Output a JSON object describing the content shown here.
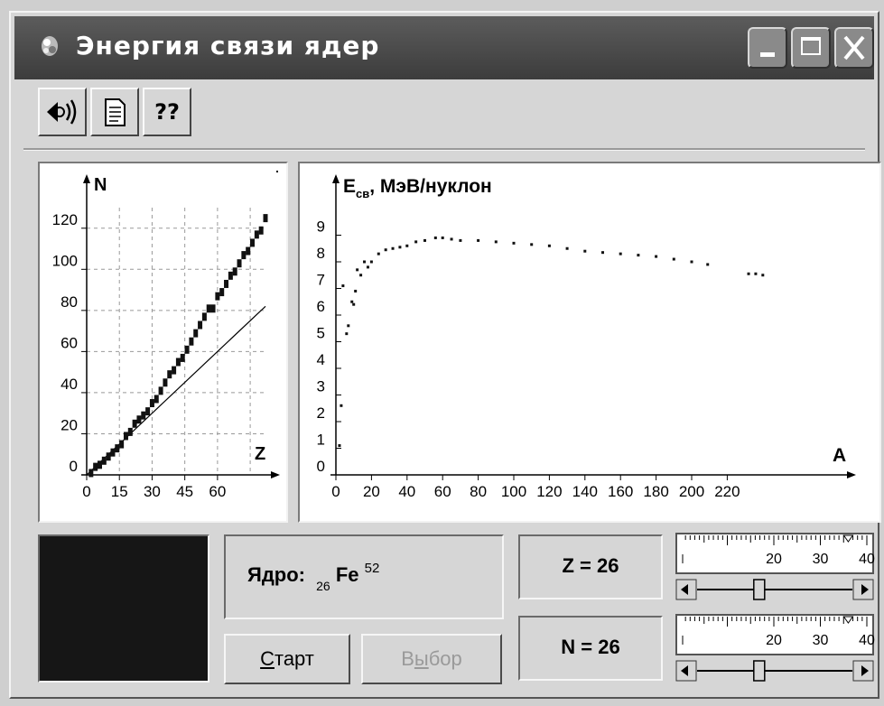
{
  "window": {
    "title": "Энергия связи ядер"
  },
  "toolbar": {
    "help_label": "??"
  },
  "left_chart": {
    "ylabel": "N",
    "xlabel": "Z",
    "xticks": [
      0,
      15,
      30,
      45,
      60
    ],
    "yticks": [
      0,
      20,
      40,
      60,
      80,
      100,
      120
    ]
  },
  "right_chart": {
    "ylabel_main": "E",
    "ylabel_sub": "св",
    "ylabel_rest": ", МэВ/нуклон",
    "xlabel": "A",
    "xticks": [
      0,
      20,
      40,
      60,
      80,
      100,
      120,
      140,
      160,
      180,
      200,
      220
    ],
    "yticks": [
      0,
      1,
      2,
      3,
      4,
      5,
      6,
      7,
      8,
      9
    ]
  },
  "chart_data": [
    {
      "type": "scatter",
      "xlabel": "Z",
      "ylabel": "N",
      "xlim": [
        0,
        82
      ],
      "ylim": [
        0,
        130
      ],
      "series": [
        {
          "x": [
            2,
            4,
            6,
            8,
            10,
            12,
            14,
            16,
            18,
            20,
            22,
            24,
            26,
            28,
            30,
            32,
            34,
            36,
            38,
            40,
            42,
            44,
            46,
            48,
            50,
            52,
            54,
            56,
            58,
            60,
            62,
            64,
            66,
            68,
            70,
            72,
            74,
            76,
            78,
            80,
            82
          ],
          "y": [
            2,
            5,
            6,
            8,
            10,
            12,
            14,
            16,
            20,
            22,
            26,
            28,
            30,
            32,
            36,
            38,
            42,
            46,
            50,
            52,
            56,
            58,
            62,
            66,
            70,
            74,
            78,
            82,
            82,
            88,
            90,
            94,
            98,
            100,
            104,
            108,
            110,
            114,
            118,
            120,
            126
          ]
        },
        {
          "x": [
            0,
            82
          ],
          "y": [
            0,
            82
          ]
        }
      ]
    },
    {
      "type": "scatter",
      "xlabel": "A",
      "ylabel": "Eсв, МэВ/нуклон",
      "xlim": [
        0,
        240
      ],
      "ylim": [
        0,
        9.5
      ],
      "series": [
        {
          "x": [
            2,
            3,
            4,
            6,
            7,
            9,
            10,
            11,
            12,
            14,
            16,
            18,
            20,
            24,
            28,
            32,
            36,
            40,
            45,
            50,
            56,
            60,
            65,
            70,
            80,
            90,
            100,
            110,
            120,
            130,
            140,
            150,
            160,
            170,
            180,
            190,
            200,
            209,
            232,
            236,
            240
          ],
          "y": [
            1.1,
            2.6,
            7.1,
            5.3,
            5.6,
            6.5,
            6.4,
            6.9,
            7.7,
            7.5,
            8.0,
            7.8,
            8.0,
            8.3,
            8.45,
            8.5,
            8.55,
            8.6,
            8.75,
            8.8,
            8.9,
            8.9,
            8.85,
            8.8,
            8.8,
            8.75,
            8.7,
            8.65,
            8.6,
            8.5,
            8.4,
            8.35,
            8.3,
            8.25,
            8.2,
            8.1,
            8.0,
            7.9,
            7.55,
            7.55,
            7.5
          ]
        }
      ]
    }
  ],
  "nucleus": {
    "label": "Ядро:",
    "z": "26",
    "symbol": "Fe",
    "a": "52"
  },
  "buttons": {
    "start": "Старт",
    "start_mnemonic": "С",
    "start_rest": "тарт",
    "select": "Выбор",
    "select_a": "В",
    "select_m": "ы",
    "select_b": "бор"
  },
  "z_box": "Z = 26",
  "n_box": "N = 26",
  "slider_z": {
    "scale": [
      "20",
      "30",
      "40"
    ],
    "value": 26
  },
  "slider_n": {
    "scale": [
      "20",
      "30",
      "40"
    ],
    "value": 26
  },
  "colors": {
    "title_bg": "#4a4a4a",
    "window_bg": "#d6d6d6",
    "preview_bg": "#161616"
  }
}
